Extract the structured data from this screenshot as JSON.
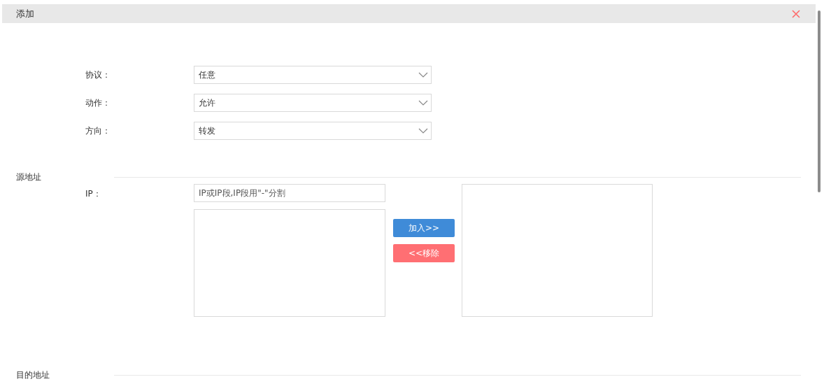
{
  "dialog": {
    "title": "添加"
  },
  "fields": [
    {
      "label": "协议：",
      "value": "任意"
    },
    {
      "label": "动作：",
      "value": "允许"
    },
    {
      "label": "方向：",
      "value": "转发"
    }
  ],
  "source_section": {
    "title": "源地址",
    "ip_label": "IP：",
    "ip_input": {
      "placeholder": "IP或IP段,IP段用\"-\"分割"
    },
    "buttons": [
      {
        "label": "加入>>",
        "kind": "add"
      },
      {
        "label": "<<移除",
        "kind": "remove"
      }
    ]
  },
  "destination_section": {
    "title": "目的地址"
  }
}
